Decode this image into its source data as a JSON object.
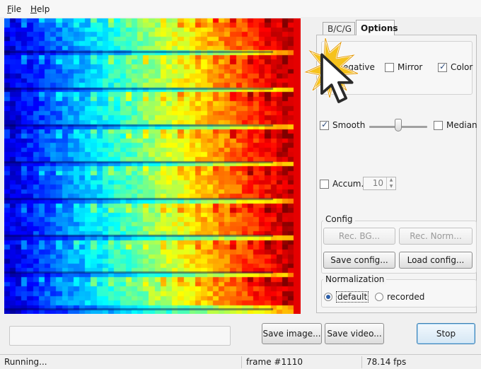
{
  "menu": {
    "file": "File",
    "help": "Help"
  },
  "tabs": {
    "bcg": "B/C/G",
    "options": "Options"
  },
  "options": {
    "negative_label": "Negative",
    "negative_checked": false,
    "mirror_label": "Mirror",
    "mirror_checked": false,
    "color_label": "Color",
    "color_checked": true,
    "smooth_label": "Smooth",
    "smooth_checked": true,
    "median_label": "Median",
    "median_checked": false,
    "smooth_slider_level": 0.5,
    "accum_label": "Accum.",
    "accum_checked": false,
    "accum_value": "10"
  },
  "config": {
    "title": "Config",
    "rec_bg": "Rec. BG...",
    "rec_norm": "Rec. Norm...",
    "save": "Save config...",
    "load": "Load config..."
  },
  "normalization": {
    "title": "Normalization",
    "default_label": "default",
    "recorded_label": "recorded",
    "selected": "default"
  },
  "bottom": {
    "save_image": "Save image...",
    "save_video": "Save video...",
    "stop": "Stop"
  },
  "status": {
    "state": "Running...",
    "frame": "frame #1110",
    "fps": "78.14 fps"
  },
  "colors": {
    "highlight_yellow": "#f6c21c",
    "focus_blue": "#3c7fb1"
  }
}
